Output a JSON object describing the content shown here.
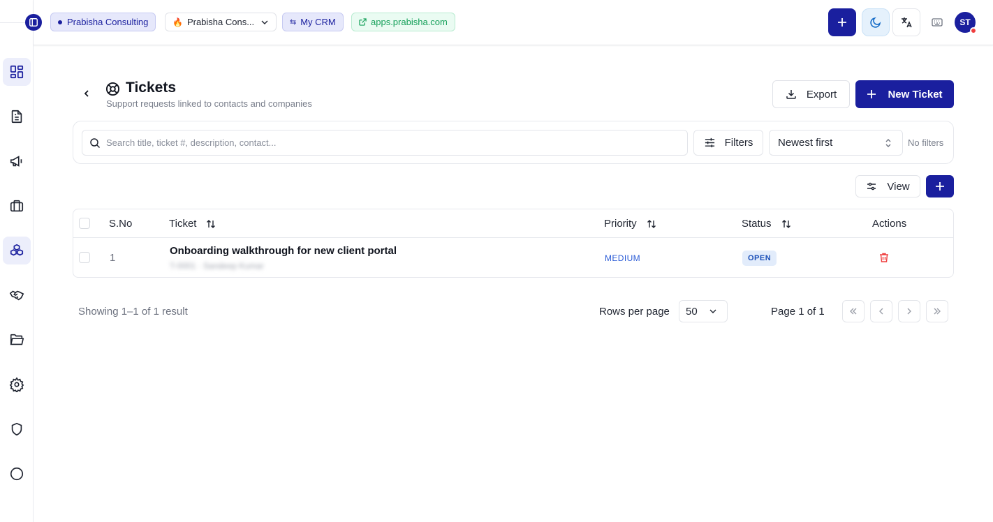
{
  "header": {
    "org_chip": "Prabisha Consulting",
    "workspace_select": "Prabisha Cons...",
    "crm_chip": "My CRM",
    "app_link": "apps.prabisha.com",
    "avatar_initials": "ST"
  },
  "sidebar": {
    "items": [
      {
        "icon": "dashboard-icon",
        "active": true
      },
      {
        "icon": "document-icon",
        "active": false
      },
      {
        "icon": "megaphone-icon",
        "active": false
      },
      {
        "icon": "briefcase-icon",
        "active": false
      },
      {
        "icon": "boxes-icon",
        "active": true
      },
      {
        "icon": "handshake-icon",
        "active": false
      },
      {
        "icon": "folder-icon",
        "active": false
      },
      {
        "icon": "gear-icon",
        "active": false
      },
      {
        "icon": "shield-icon",
        "active": false
      },
      {
        "icon": "circle-icon",
        "active": false
      }
    ]
  },
  "page": {
    "title": "Tickets",
    "subtitle": "Support requests linked to contacts and companies",
    "export_label": "Export",
    "new_ticket_label": "New Ticket"
  },
  "filters": {
    "search_placeholder": "Search title, ticket #, description, contact...",
    "filters_label": "Filters",
    "sort_value": "Newest first",
    "status_text": "No filters"
  },
  "toolbar": {
    "view_label": "View"
  },
  "table": {
    "columns": [
      "S.No",
      "Ticket",
      "Priority",
      "Status",
      "Actions"
    ],
    "rows": [
      {
        "sno": "1",
        "title": "Onboarding walkthrough for new client portal",
        "meta": "T-0001 · Sandeep Kumar",
        "priority": "MEDIUM",
        "status": "OPEN"
      }
    ]
  },
  "footer": {
    "showing": "Showing 1–1 of 1 result",
    "rows_per_page_label": "Rows per page",
    "rows_per_page_value": "50",
    "page_label": "Page 1 of 1"
  },
  "colors": {
    "brand": "#1a1f9e",
    "priority_medium": "#2a5bd6",
    "status_open_bg": "#e2ecfb",
    "danger": "#ef3e3e"
  }
}
